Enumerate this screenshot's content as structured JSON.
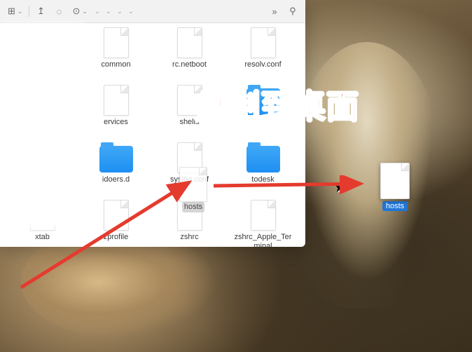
{
  "toolbar": {
    "view_icon": "⊞",
    "share_icon": "↥",
    "tag_icon": "◌",
    "action_icon": "⊙",
    "more_icon": "»",
    "search_icon": "⚲"
  },
  "files": [
    {
      "name": "",
      "type": "doc",
      "hidden": true
    },
    {
      "name": "common",
      "type": "doc"
    },
    {
      "name": "rc.netboot",
      "type": "doc"
    },
    {
      "name": "resolv.conf",
      "type": "doc"
    },
    {
      "name": "",
      "type": "blank"
    },
    {
      "name": "ervices",
      "type": "doc"
    },
    {
      "name": "shells",
      "type": "doc"
    },
    {
      "name": "",
      "type": "folder"
    },
    {
      "name": "",
      "type": "blank"
    },
    {
      "name": "idoers.d",
      "type": "folder"
    },
    {
      "name": "syslog.conf",
      "type": "doc"
    },
    {
      "name": "todesk",
      "type": "folder"
    },
    {
      "name": "xtab",
      "type": "doc"
    },
    {
      "name": "zprofile",
      "type": "doc"
    },
    {
      "name": "zshrc",
      "type": "doc"
    },
    {
      "name": "zshrc_Apple_Terminal",
      "type": "doc"
    }
  ],
  "dragging_file": {
    "name": "hosts",
    "selected": true
  },
  "desktop_file": {
    "name": "hosts"
  },
  "annotation": {
    "text": "复制到桌面"
  },
  "colors": {
    "annotation_red": "#e43b2e",
    "selection_blue": "#2176d6",
    "folder_blue": "#1e90f3"
  }
}
